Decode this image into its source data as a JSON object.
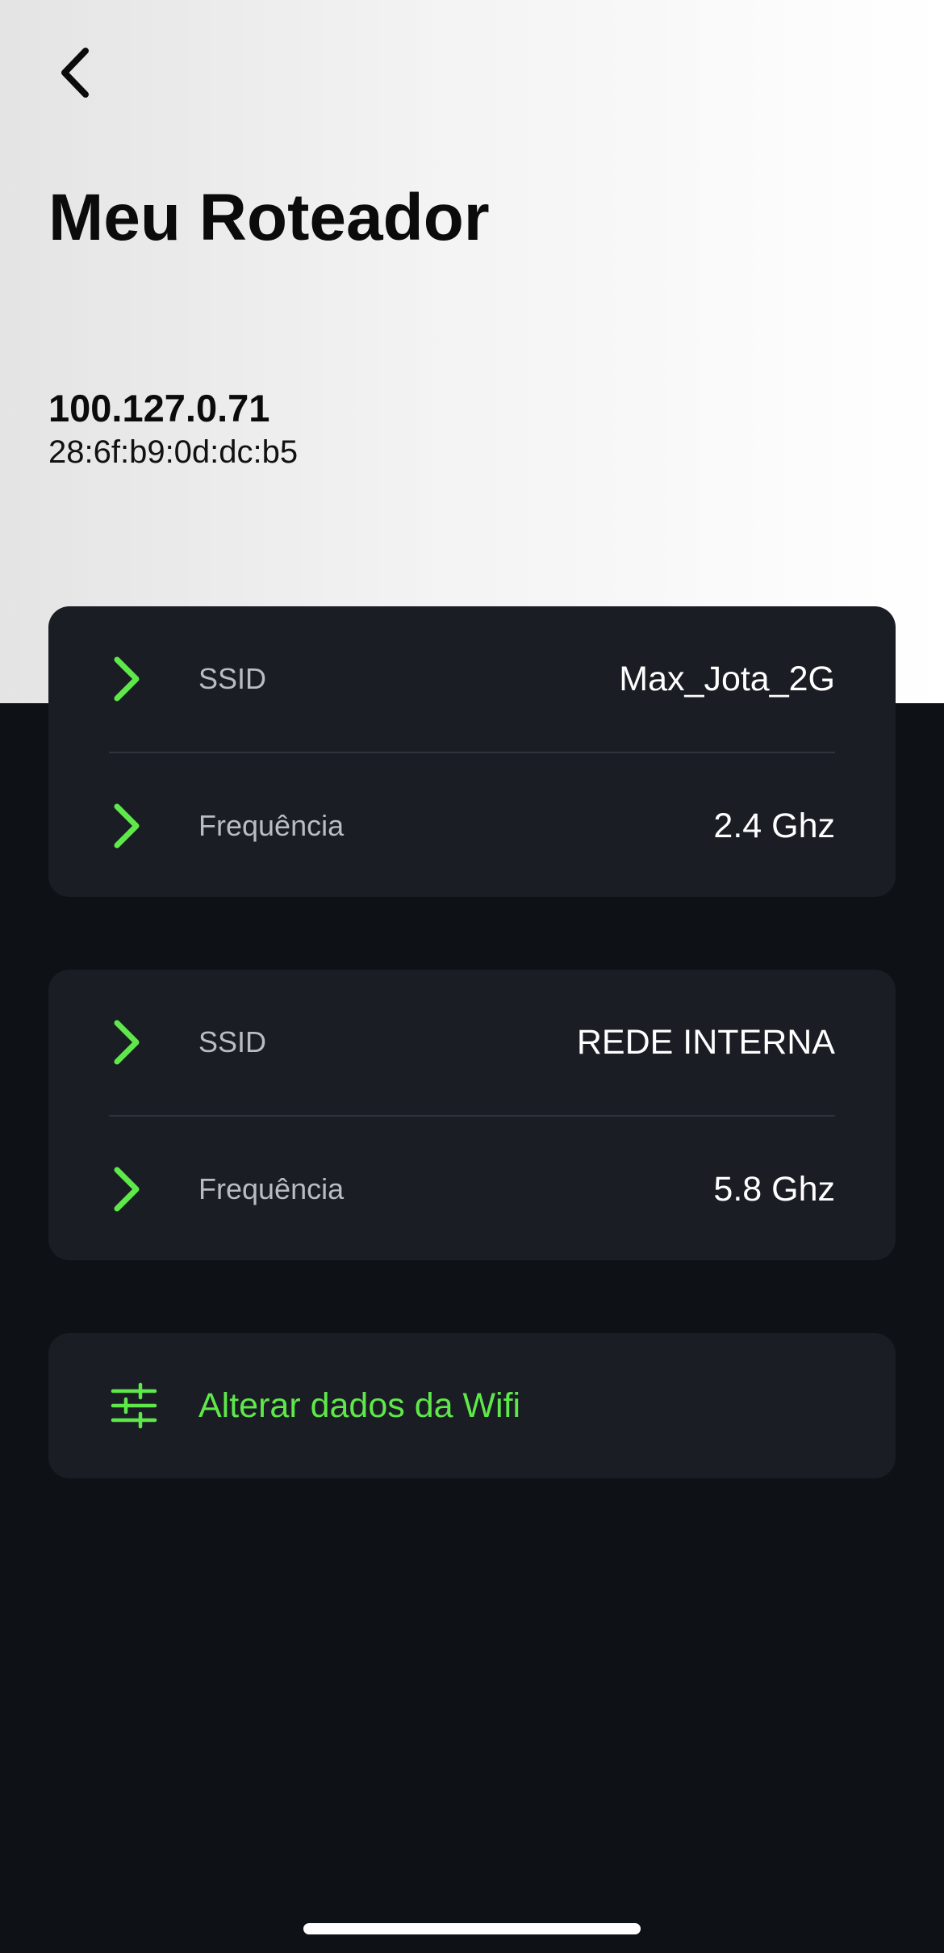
{
  "header": {
    "title": "Meu Roteador",
    "ip": "100.127.0.71",
    "mac": "28:6f:b9:0d:dc:b5"
  },
  "networks": [
    {
      "ssid_label": "SSID",
      "ssid": "Max_Jota_2G",
      "frequency_label": "Frequência",
      "frequency": "2.4 Ghz"
    },
    {
      "ssid_label": "SSID",
      "ssid": "REDE INTERNA",
      "frequency_label": "Frequência",
      "frequency": "5.8 Ghz"
    }
  ],
  "action": {
    "label": "Alterar dados da Wifi",
    "icon": "sliders-icon"
  },
  "icons": {
    "back": "chevron-left-icon",
    "row": "chevron-right-icon"
  },
  "colors": {
    "accent": "#5fe84a",
    "card": "#1a1d24",
    "background": "#0e1116"
  }
}
